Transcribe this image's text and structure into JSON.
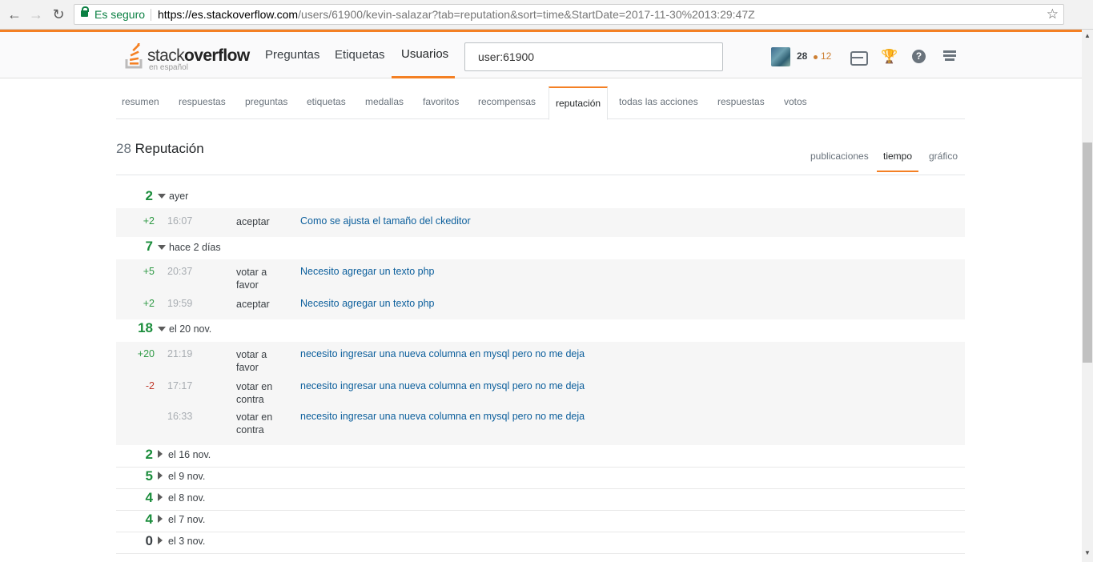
{
  "browser": {
    "secure_label": "Es seguro",
    "url_host": "https://es.stackoverflow.com",
    "url_rest": "/users/61900/kevin-salazar?tab=reputation&sort=time&StartDate=2017-11-30%2013:29:47Z"
  },
  "topbar": {
    "logo_text_light": "stack",
    "logo_text_bold": "overflow",
    "logo_sub": "en español",
    "nav": [
      "Preguntas",
      "Etiquetas",
      "Usuarios"
    ],
    "search_value": "user:61900",
    "reputation": "28",
    "bronze": "12",
    "help_glyph": "?"
  },
  "tabs": [
    "resumen",
    "respuestas",
    "preguntas",
    "etiquetas",
    "medallas",
    "favoritos",
    "recompensas",
    "reputación",
    "todas las acciones",
    "respuestas",
    "votos"
  ],
  "header": {
    "rep_number": "28",
    "rep_label": "Reputación",
    "sort_options": [
      "publicaciones",
      "tiempo",
      "gráfico"
    ]
  },
  "groups": [
    {
      "total": "2",
      "label": "ayer",
      "expanded": true,
      "items": [
        {
          "delta": "+2",
          "time": "16:07",
          "action": "aceptar",
          "title": "Como se ajusta el tamaño del ckeditor"
        }
      ]
    },
    {
      "total": "7",
      "label": "hace 2 días",
      "expanded": true,
      "items": [
        {
          "delta": "+5",
          "time": "20:37",
          "action": "votar a favor",
          "title": "Necesito agregar un texto php"
        },
        {
          "delta": "+2",
          "time": "19:59",
          "action": "aceptar",
          "title": "Necesito agregar un texto php"
        }
      ]
    },
    {
      "total": "18",
      "label": "el 20 nov.",
      "expanded": true,
      "items": [
        {
          "delta": "+20",
          "time": "21:19",
          "action": "votar a favor",
          "title": "necesito ingresar una nueva columna en mysql pero no me deja"
        },
        {
          "delta": "-2",
          "time": "17:17",
          "action": "votar en contra",
          "title": "necesito ingresar una nueva columna en mysql pero no me deja"
        },
        {
          "delta": "",
          "time": "16:33",
          "action": "votar en contra",
          "title": "necesito ingresar una nueva columna en mysql pero no me deja"
        }
      ]
    },
    {
      "total": "2",
      "label": "el 16 nov.",
      "expanded": false
    },
    {
      "total": "5",
      "label": "el 9 nov.",
      "expanded": false
    },
    {
      "total": "4",
      "label": "el 8 nov.",
      "expanded": false
    },
    {
      "total": "4",
      "label": "el 7 nov.",
      "expanded": false
    },
    {
      "total": "0",
      "label": "el 3 nov.",
      "expanded": false
    }
  ],
  "colors": {
    "accent": "#f48024",
    "positive": "#1b8d3c",
    "negative": "#c0392b",
    "link": "#0c5f9c",
    "bronze": "#cd7f32"
  }
}
